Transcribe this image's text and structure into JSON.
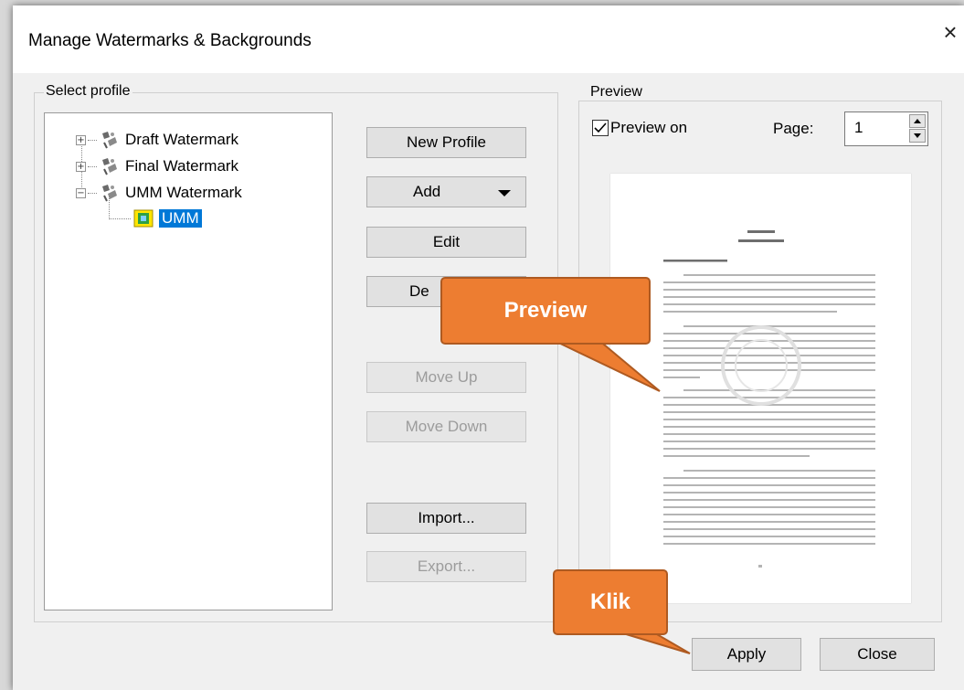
{
  "window": {
    "title": "Manage Watermarks & Backgrounds",
    "close_glyph": "×"
  },
  "select_profile": {
    "legend": "Select profile",
    "tree": [
      {
        "label": "Draft Watermark",
        "expander": "+"
      },
      {
        "label": "Final Watermark",
        "expander": "+"
      },
      {
        "label": "UMM Watermark",
        "expander": "−"
      },
      {
        "label": "UMM",
        "selected": true
      }
    ]
  },
  "buttons": {
    "new_profile": "New Profile",
    "add": "Add",
    "edit": "Edit",
    "delete": "De",
    "move_up": "Move Up",
    "move_down": "Move Down",
    "import": "Import...",
    "export": "Export...",
    "apply": "Apply",
    "close": "Close"
  },
  "preview": {
    "legend": "Preview",
    "preview_on_label": "Preview on",
    "preview_on_checked": true,
    "page_label": "Page:",
    "page_value": "1"
  },
  "annotations": {
    "preview": "Preview",
    "klik": "Klik"
  },
  "colors": {
    "accent": "#0078d7",
    "callout": "#ed7d31"
  }
}
